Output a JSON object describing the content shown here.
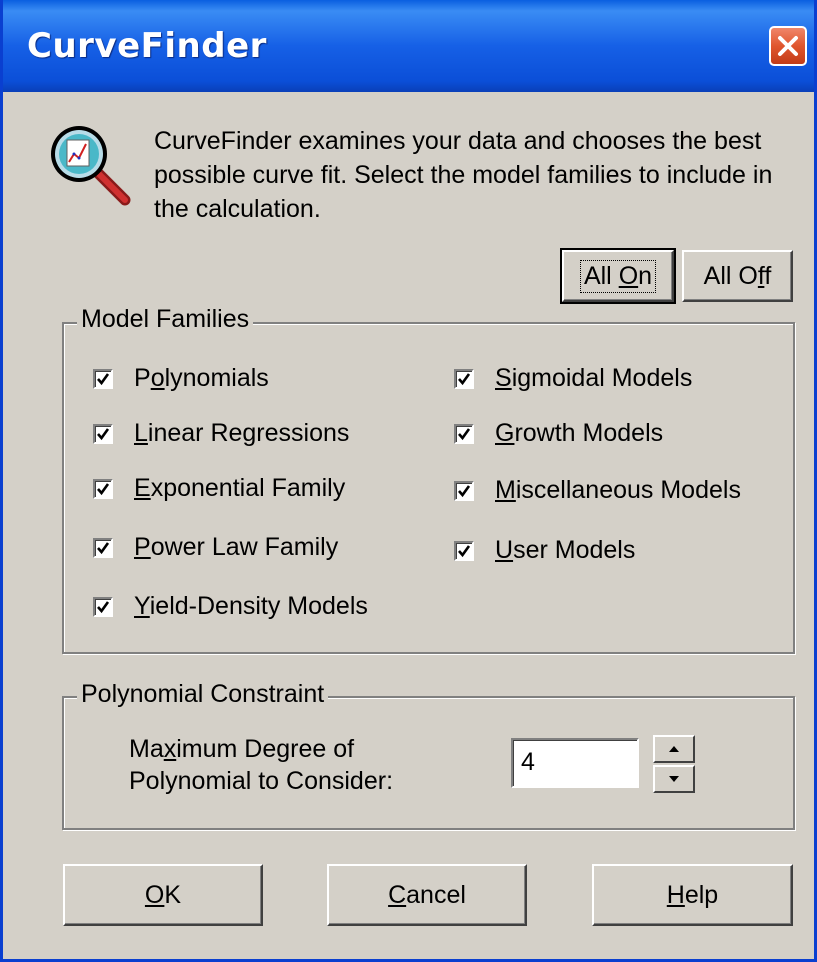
{
  "window": {
    "title": "CurveFinder",
    "close_icon": "close-icon"
  },
  "header": {
    "icon": "magnifier-chart-icon",
    "description": "CurveFinder examines your data and chooses the best possible curve fit. Select the model families to include in the calculation."
  },
  "toggle_buttons": {
    "all_on": {
      "pre": "All ",
      "ul": "O",
      "post": "n"
    },
    "all_off": {
      "pre": "All O",
      "ul": "f",
      "post": "f"
    }
  },
  "model_families": {
    "label": "Model Families",
    "left": [
      {
        "pre": "P",
        "ul": "o",
        "post": "lynomials",
        "checked": true
      },
      {
        "pre": "",
        "ul": "L",
        "post": "inear Regressions",
        "checked": true
      },
      {
        "pre": "",
        "ul": "E",
        "post": "xponential Family",
        "checked": true
      },
      {
        "pre": "",
        "ul": "P",
        "post": "ower Law Family",
        "checked": true
      },
      {
        "pre": "",
        "ul": "Y",
        "post": "ield-Density Models",
        "checked": true
      }
    ],
    "right": [
      {
        "pre": "",
        "ul": "S",
        "post": "igmoidal Models",
        "checked": true
      },
      {
        "pre": "",
        "ul": "G",
        "post": "rowth Models",
        "checked": true
      },
      {
        "pre": "",
        "ul": "M",
        "post": "iscellaneous Models",
        "checked": true
      },
      {
        "pre": "",
        "ul": "U",
        "post": "ser Models",
        "checked": true
      }
    ]
  },
  "polynomial_constraint": {
    "label": "Polynomial Constraint",
    "line1": {
      "pre": "Ma",
      "ul": "x",
      "post": "imum Degree of"
    },
    "line2": "Polynomial to Consider:",
    "value": "4"
  },
  "footer": {
    "ok": {
      "pre": "",
      "ul": "O",
      "post": "K"
    },
    "cancel": {
      "pre": "",
      "ul": "C",
      "post": "ancel"
    },
    "help": {
      "pre": "",
      "ul": "H",
      "post": "elp"
    }
  }
}
